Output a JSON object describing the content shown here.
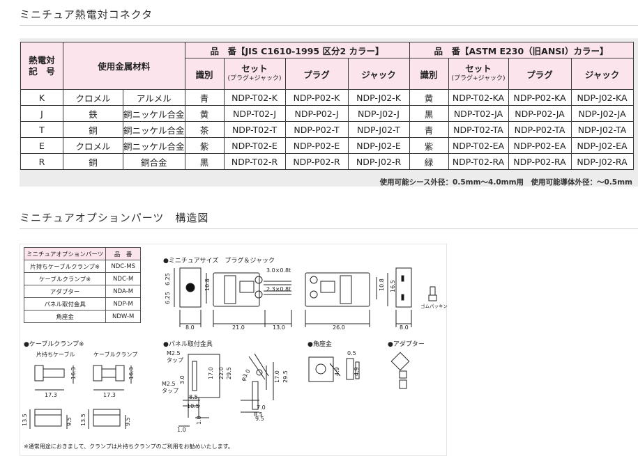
{
  "section1": {
    "title": "ミニチュア熱電対コネクタ",
    "header": {
      "symbol": "熱電対\n記　号",
      "material": "使用金属材料",
      "group_jis": "品　番【JIS C1610-1995 区分2 カラー】",
      "group_astm": "品　番【ASTM E230（旧ANSI）カラー】",
      "type": "識別",
      "set": "セット",
      "set_sub": "(プラグ+ジャック)",
      "plug": "プラグ",
      "jack": "ジャック"
    },
    "rows": [
      {
        "sym": "K",
        "m1": "クロメル",
        "m2": "アルメル",
        "jc": "青",
        "js": "NDP-T02-K",
        "jp": "NDP-P02-K",
        "jj": "NDP-J02-K",
        "ac": "黄",
        "as": "NDP-T02-KA",
        "ap": "NDP-P02-KA",
        "aj": "NDP-J02-KA"
      },
      {
        "sym": "J",
        "m1": "鉄",
        "m2": "銅ニッケル合金",
        "jc": "黄",
        "js": "NDP-T02-J",
        "jp": "NDP-P02-J",
        "jj": "NDP-J02-J",
        "ac": "黒",
        "as": "NDP-T02-JA",
        "ap": "NDP-P02-JA",
        "aj": "NDP-J02-JA"
      },
      {
        "sym": "T",
        "m1": "銅",
        "m2": "銅ニッケル合金",
        "jc": "茶",
        "js": "NDP-T02-T",
        "jp": "NDP-P02-T",
        "jj": "NDP-J02-T",
        "ac": "青",
        "as": "NDP-T02-TA",
        "ap": "NDP-P02-TA",
        "aj": "NDP-J02-TA"
      },
      {
        "sym": "E",
        "m1": "クロメル",
        "m2": "銅ニッケル合金",
        "jc": "紫",
        "js": "NDP-T02-E",
        "jp": "NDP-P02-E",
        "jj": "NDP-J02-E",
        "ac": "紫",
        "as": "NDP-T02-EA",
        "ap": "NDP-P02-EA",
        "aj": "NDP-J02-EA"
      },
      {
        "sym": "R",
        "m1": "銅",
        "m2": "銅合金",
        "jc": "黒",
        "js": "NDP-T02-R",
        "jp": "NDP-P02-R",
        "jj": "NDP-J02-R",
        "ac": "緑",
        "as": "NDP-T02-RA",
        "ap": "NDP-P02-RA",
        "aj": "NDP-J02-RA"
      }
    ],
    "note": "使用可能シース外径：0.5mm〜4.0mm用　使用可能導体外径：〜0.5mm"
  },
  "section2": {
    "title": "ミニチュアオプションパーツ　構造図",
    "parts_header": {
      "name": "ミニチュアオプションパーツ",
      "code": "品　番"
    },
    "parts": [
      {
        "name": "片持ちケーブルクランプ※",
        "code": "NDC-MS"
      },
      {
        "name": "ケーブルクランプ※",
        "code": "NDC-M"
      },
      {
        "name": "アダプター",
        "code": "NDA-M"
      },
      {
        "name": "パネル取付金具",
        "code": "NDP-M"
      },
      {
        "name": "角座金",
        "code": "NDW-M"
      }
    ],
    "labels": {
      "mini": "●ミニチュアサイズ　プラグ＆ジャック",
      "clamp": "●ケーブルクランプ※",
      "clamp_single": "片持ちケーブル",
      "clamp_double": "ケーブルクランプ",
      "panel": "●パネル取付金具",
      "washer": "●角座金",
      "adapter": "●アダプター",
      "gomu": "ゴムパッキン",
      "tap1": "M2.5\nタップ",
      "tap2": "M2.5\nタップ"
    },
    "dims": [
      "6.25",
      "6.25",
      "10.8",
      "8.0",
      "21.0",
      "13.0",
      "3.0×0.8t",
      "2.3×0.8t",
      "26.0",
      "10.8",
      "16.5",
      "8.0",
      "16.3",
      "17.3",
      "16.3",
      "17.3",
      "13.5",
      "9.5",
      "13.5",
      "9.5",
      "3.0",
      "17.0",
      "22.0",
      "29.5",
      "φ3.0",
      "17.0",
      "29.5",
      "8.5",
      "10.5",
      "7.0",
      "8.5",
      "9.5",
      "1.0",
      "1.0",
      "0.5",
      "4.9",
      "4.9"
    ],
    "bottom_note": "※通常用途におきまして、クランプは片持ちクランプのご利用をお勧めいたします。"
  }
}
